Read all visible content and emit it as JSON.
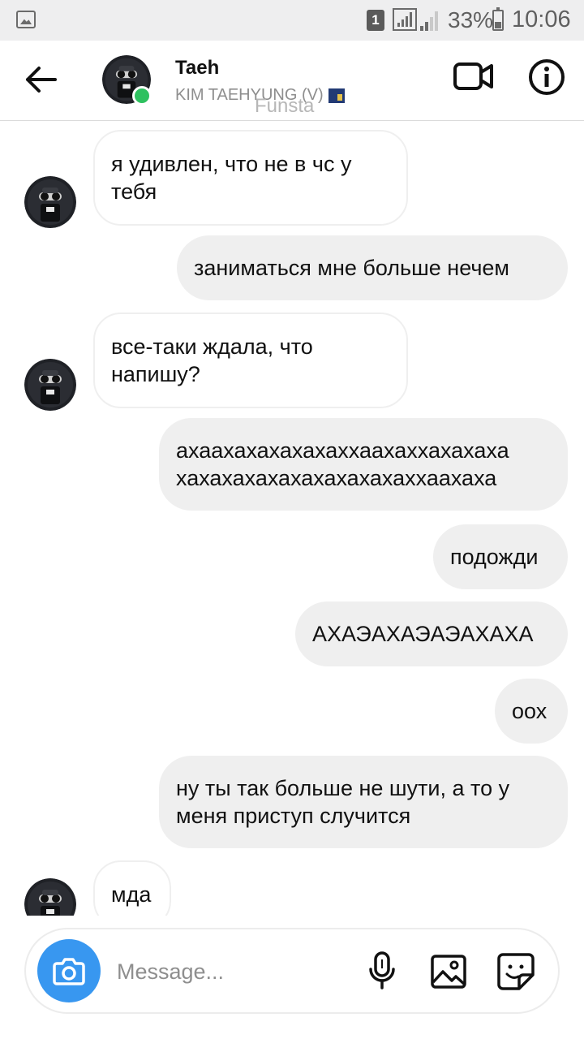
{
  "status_bar": {
    "sim": "1",
    "battery": "33%",
    "time": "10:06"
  },
  "header": {
    "name": "Taeh",
    "username": "KIM TAEHYUNG (V)",
    "watermark": "Funsta"
  },
  "messages": [
    {
      "dir": "in",
      "text": "я удивлен, что не в чс у тебя"
    },
    {
      "dir": "out",
      "text": "заниматься мне больше нечем"
    },
    {
      "dir": "in",
      "text": "все-таки ждала, что напишу?"
    },
    {
      "dir": "out",
      "text": "ахаахахахахахаххаахаххахахаха хахахахахахахахахахаххаахаха"
    },
    {
      "dir": "out",
      "text": "подожди"
    },
    {
      "dir": "out",
      "text": "АХАЭАХАЭАЭАХАХА"
    },
    {
      "dir": "out",
      "text": "оох"
    },
    {
      "dir": "out",
      "text": "ну ты так больше не шути, а то у меня приступ случится"
    },
    {
      "dir": "in",
      "text": "мда"
    }
  ],
  "composer": {
    "placeholder": "Message..."
  },
  "colors": {
    "accent": "#3897f0",
    "online": "#2ec15f",
    "outgoing_bubble": "#efefef"
  }
}
